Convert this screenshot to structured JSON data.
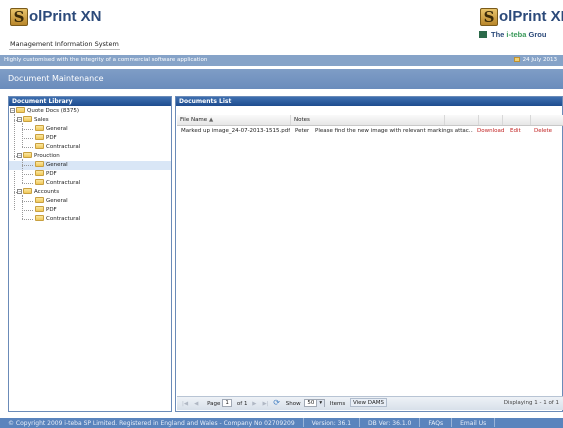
{
  "header": {
    "logo_letter": "S",
    "logo_rest": "olPrint XN",
    "subtitle": "Management Information System",
    "right_logo_letter": "S",
    "right_logo_rest": "olPrint XN",
    "group_prefix": "The ",
    "group_name": "i-teba",
    "group_suffix": " Grou"
  },
  "tagline": "Highly customised with the integrity of a commercial software application",
  "date": "24 July 2013",
  "page_title": "Document Maintenance",
  "library": {
    "title": "Document Library",
    "root": "Quote Docs (8375)",
    "groups": [
      {
        "name": "Sales",
        "children": [
          "General",
          "PDF",
          "Contractural"
        ]
      },
      {
        "name": "Prouction",
        "children": [
          "General",
          "PDF",
          "Contractural"
        ]
      },
      {
        "name": "Accounts",
        "children": [
          "General",
          "PDF",
          "Contractural"
        ]
      }
    ]
  },
  "documents": {
    "title": "Documents List",
    "columns": [
      "File Name",
      "Notes"
    ],
    "rows": [
      {
        "file": "Marked up image_24-07-2013-1515.pdf",
        "user": "Peter",
        "note": "Please find the new image with relevant markings attac...",
        "download": "Download",
        "edit": "Edit",
        "delete": "Delete"
      }
    ]
  },
  "pager": {
    "page_label": "Page",
    "page": "1",
    "of": "of 1",
    "show": "Show",
    "size": "50",
    "items": "Items",
    "view": "View DAMS",
    "displaying": "Displaying 1 - 1 of 1"
  },
  "footer": {
    "copyright": "© Copyright 2009 i-teba SP Limited. Registered in England and Wales - Company No 02709209",
    "version": "Version: 36.1",
    "db": "DB Ver: 36.1.0",
    "faqs": "FAQs",
    "email": "Email Us"
  },
  "colors": {
    "accent": "#1e4c8e",
    "band": "#86a3c8",
    "link": "#c02020",
    "selected": "#d9e6f6"
  }
}
